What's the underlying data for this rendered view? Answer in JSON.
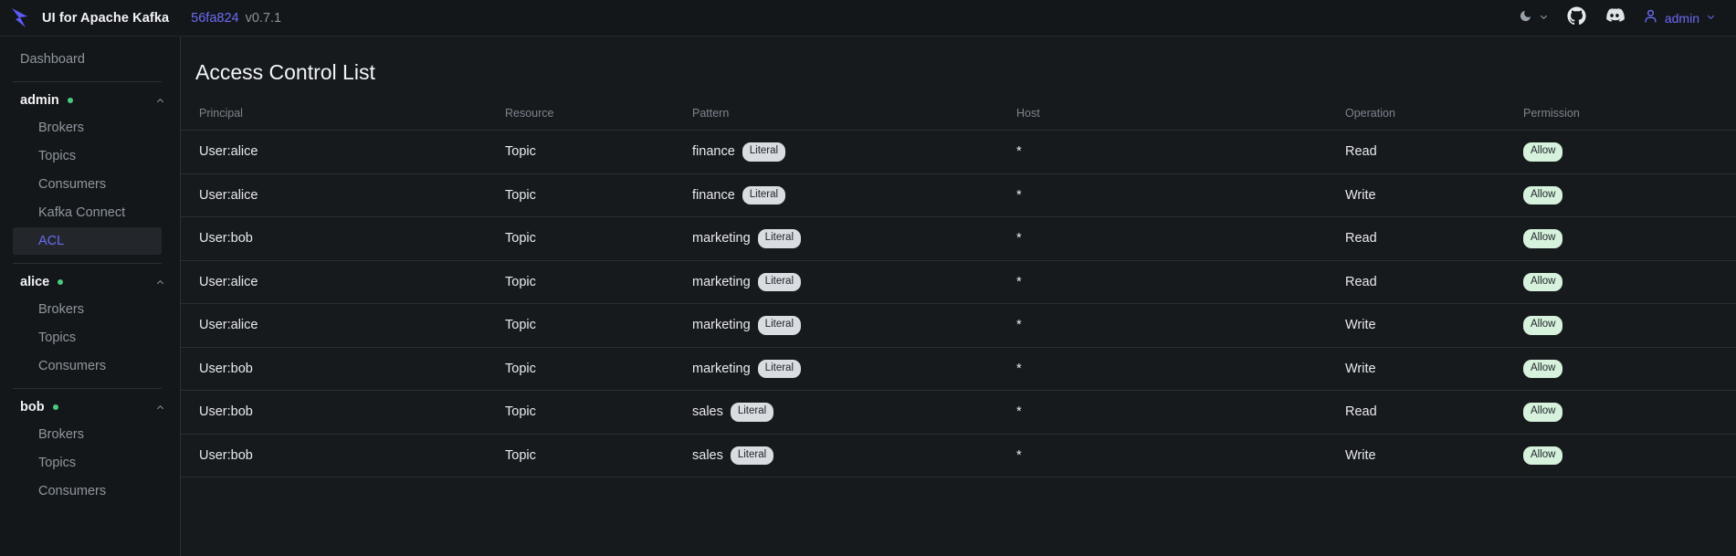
{
  "header": {
    "logo_icon": "kafka-arrow-logo",
    "brand": "UI for Apache Kafka",
    "commit": "56fa824",
    "version": "v0.7.1",
    "theme_icon": "moon-icon",
    "theme_chevron_icon": "chevron-down-icon",
    "github_icon": "github-icon",
    "discord_icon": "discord-icon",
    "user_icon": "user-icon",
    "user_name": "admin",
    "user_chevron_icon": "chevron-down-icon"
  },
  "sidebar": {
    "dashboard_label": "Dashboard",
    "clusters": [
      {
        "name": "admin",
        "status": "online",
        "chevron_icon": "chevron-up-icon",
        "items": [
          "Brokers",
          "Topics",
          "Consumers",
          "Kafka Connect",
          "ACL"
        ],
        "active_item": "ACL"
      },
      {
        "name": "alice",
        "status": "online",
        "chevron_icon": "chevron-up-icon",
        "items": [
          "Brokers",
          "Topics",
          "Consumers"
        ],
        "active_item": ""
      },
      {
        "name": "bob",
        "status": "online",
        "chevron_icon": "chevron-up-icon",
        "items": [
          "Brokers",
          "Topics",
          "Consumers"
        ],
        "active_item": ""
      }
    ]
  },
  "main": {
    "title": "Access Control List",
    "table": {
      "columns": [
        "Principal",
        "Resource",
        "Pattern",
        "Host",
        "Operation",
        "Permission"
      ],
      "rows": [
        {
          "principal": "User:alice",
          "resource": "Topic",
          "pattern": "finance",
          "pattern_badge": "Literal",
          "host": "*",
          "operation": "Read",
          "permission": "Allow"
        },
        {
          "principal": "User:alice",
          "resource": "Topic",
          "pattern": "finance",
          "pattern_badge": "Literal",
          "host": "*",
          "operation": "Write",
          "permission": "Allow"
        },
        {
          "principal": "User:bob",
          "resource": "Topic",
          "pattern": "marketing",
          "pattern_badge": "Literal",
          "host": "*",
          "operation": "Read",
          "permission": "Allow"
        },
        {
          "principal": "User:alice",
          "resource": "Topic",
          "pattern": "marketing",
          "pattern_badge": "Literal",
          "host": "*",
          "operation": "Read",
          "permission": "Allow"
        },
        {
          "principal": "User:alice",
          "resource": "Topic",
          "pattern": "marketing",
          "pattern_badge": "Literal",
          "host": "*",
          "operation": "Write",
          "permission": "Allow"
        },
        {
          "principal": "User:bob",
          "resource": "Topic",
          "pattern": "marketing",
          "pattern_badge": "Literal",
          "host": "*",
          "operation": "Write",
          "permission": "Allow"
        },
        {
          "principal": "User:bob",
          "resource": "Topic",
          "pattern": "sales",
          "pattern_badge": "Literal",
          "host": "*",
          "operation": "Read",
          "permission": "Allow"
        },
        {
          "principal": "User:bob",
          "resource": "Topic",
          "pattern": "sales",
          "pattern_badge": "Literal",
          "host": "*",
          "operation": "Write",
          "permission": "Allow"
        }
      ]
    }
  },
  "colors": {
    "accent": "#6b6bf5",
    "status_online": "#4bc97f",
    "badge_allow_bg": "#d6f2dc",
    "badge_literal_bg": "#d9dde1",
    "sidebar_bg": "#14171a",
    "main_bg": "#171a1d"
  }
}
